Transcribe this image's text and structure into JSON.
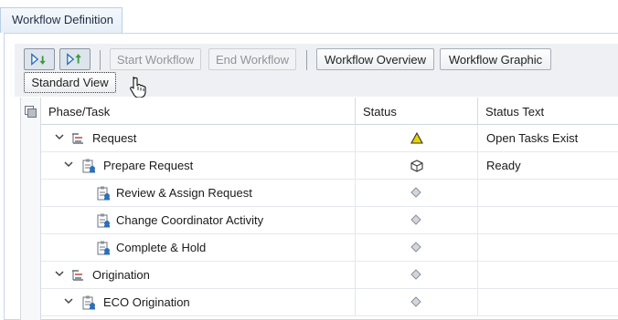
{
  "tab": {
    "label": "Workflow Definition"
  },
  "toolbar": {
    "start_workflow": "Start Workflow",
    "end_workflow": "End Workflow",
    "workflow_overview": "Workflow Overview",
    "workflow_graphic": "Workflow Graphic",
    "standard_view": "Standard View"
  },
  "columns": {
    "phase_task": "Phase/Task",
    "status": "Status",
    "status_text": "Status Text"
  },
  "rows": [
    {
      "label": "Request",
      "status_icon": "warning-triangle-icon",
      "status_text": "Open Tasks Exist"
    },
    {
      "label": "Prepare Request",
      "status_icon": "ready-cube-icon",
      "status_text": "Ready"
    },
    {
      "label": "Review & Assign Request",
      "status_icon": "inactive-diamond-icon",
      "status_text": ""
    },
    {
      "label": "Change Coordinator Activity",
      "status_icon": "inactive-diamond-icon",
      "status_text": ""
    },
    {
      "label": "Complete & Hold",
      "status_icon": "inactive-diamond-icon",
      "status_text": ""
    },
    {
      "label": "Origination",
      "status_icon": "inactive-diamond-icon",
      "status_text": ""
    },
    {
      "label": "ECO Origination",
      "status_icon": "inactive-diamond-icon",
      "status_text": ""
    }
  ],
  "colors": {
    "accent": "#4a7fb5",
    "warning": "#e8d200",
    "expand_green": "#3a9a3a"
  }
}
